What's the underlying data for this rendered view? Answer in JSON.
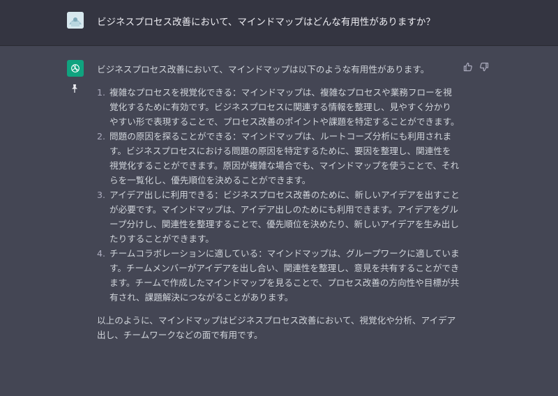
{
  "user": {
    "question": "ビジネスプロセス改善において、マインドマップはどんな有用性がありますか？"
  },
  "assistant": {
    "intro": "ビジネスプロセス改善において、マインドマップは以下のような有用性があります。",
    "items": [
      {
        "num": "1.",
        "text": "複雑なプロセスを視覚化できる：マインドマップは、複雑なプロセスや業務フローを視覚化するために有効です。ビジネスプロセスに関連する情報を整理し、見やすく分かりやすい形で表現することで、プロセス改善のポイントや課題を特定することができます。"
      },
      {
        "num": "2.",
        "text": "問題の原因を探ることができる：マインドマップは、ルートコーズ分析にも利用されます。ビジネスプロセスにおける問題の原因を特定するために、要因を整理し、関連性を視覚化することができます。原因が複雑な場合でも、マインドマップを使うことで、それらを一覧化し、優先順位を決めることができます。"
      },
      {
        "num": "3.",
        "text": "アイデア出しに利用できる：ビジネスプロセス改善のために、新しいアイデアを出すことが必要です。マインドマップは、アイデア出しのためにも利用できます。アイデアをグループ分けし、関連性を整理することで、優先順位を決めたり、新しいアイデアを生み出したりすることができます。"
      },
      {
        "num": "4.",
        "text": "チームコラボレーションに適している：マインドマップは、グループワークに適しています。チームメンバーがアイデアを出し合い、関連性を整理し、意見を共有することができます。チームで作成したマインドマップを見ることで、プロセス改善の方向性や目標が共有され、課題解決につながることがあります。"
      }
    ],
    "conclusion": "以上のように、マインドマップはビジネスプロセス改善において、視覚化や分析、アイデア出し、チームワークなどの面で有用です。"
  },
  "icons": {
    "user_avatar": "user-avatar-image",
    "assistant_avatar": "openai-logo-icon",
    "pin": "pin-icon",
    "thumbs_up": "thumbs-up-icon",
    "thumbs_down": "thumbs-down-icon"
  },
  "colors": {
    "user_bg": "#343541",
    "assistant_bg": "#444654",
    "accent": "#10a37f"
  }
}
